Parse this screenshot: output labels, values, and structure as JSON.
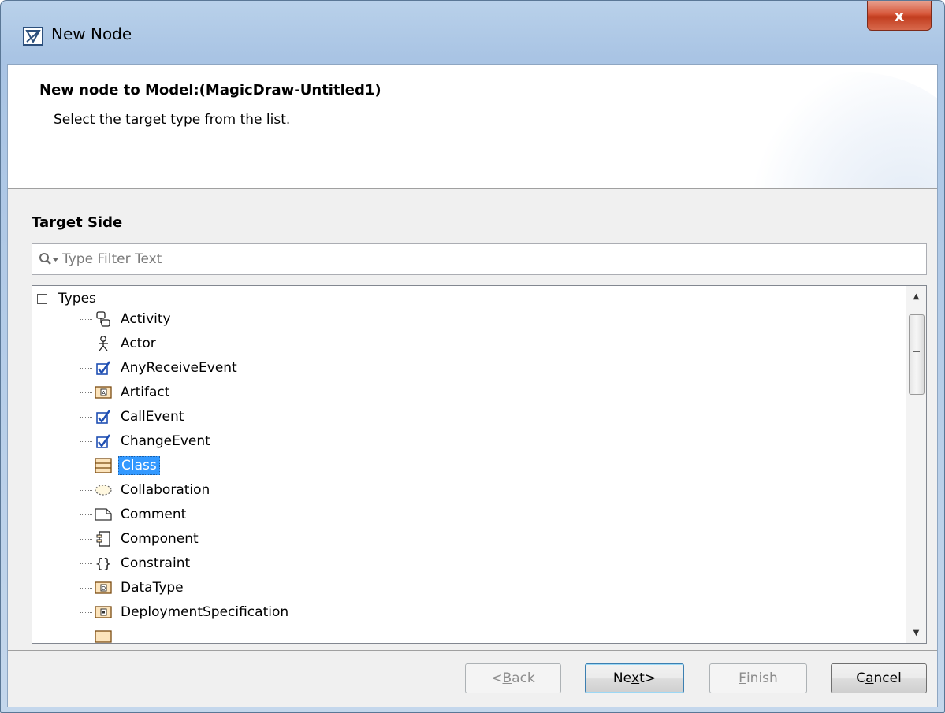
{
  "window": {
    "title": "New Node",
    "close_glyph": "x"
  },
  "header": {
    "title": "New node to Model:(MagicDraw-Untitled1)",
    "description": "Select the target type from the list."
  },
  "target": {
    "section_label": "Target Side",
    "filter_placeholder": "Type Filter Text"
  },
  "tree": {
    "root_label": "Types",
    "items": [
      {
        "label": "Activity",
        "icon": "activity-icon"
      },
      {
        "label": "Actor",
        "icon": "actor-icon"
      },
      {
        "label": "AnyReceiveEvent",
        "icon": "event-icon"
      },
      {
        "label": "Artifact",
        "icon": "artifact-icon"
      },
      {
        "label": "CallEvent",
        "icon": "event-icon"
      },
      {
        "label": "ChangeEvent",
        "icon": "event-icon"
      },
      {
        "label": "Class",
        "icon": "class-icon",
        "selected": true
      },
      {
        "label": "Collaboration",
        "icon": "collaboration-icon"
      },
      {
        "label": "Comment",
        "icon": "comment-icon"
      },
      {
        "label": "Component",
        "icon": "component-icon"
      },
      {
        "label": "Constraint",
        "icon": "constraint-icon"
      },
      {
        "label": "DataType",
        "icon": "datatype-icon"
      },
      {
        "label": "DeploymentSpecification",
        "icon": "deployment-spec-icon"
      }
    ]
  },
  "buttons": {
    "back": {
      "prefix": "<",
      "mnemonic": "B",
      "rest": "ack"
    },
    "next": {
      "prefix": "Ne",
      "mnemonic": "x",
      "rest": "t>"
    },
    "finish": {
      "prefix": "",
      "mnemonic": "F",
      "rest": "inish"
    },
    "cancel": {
      "prefix": "C",
      "mnemonic": "a",
      "rest": "ncel"
    }
  },
  "colors": {
    "selection": "#3399ff",
    "event_check": "#1f4fb3",
    "title_bar": "#b9d1ea",
    "close_button": "#c13c1e"
  }
}
